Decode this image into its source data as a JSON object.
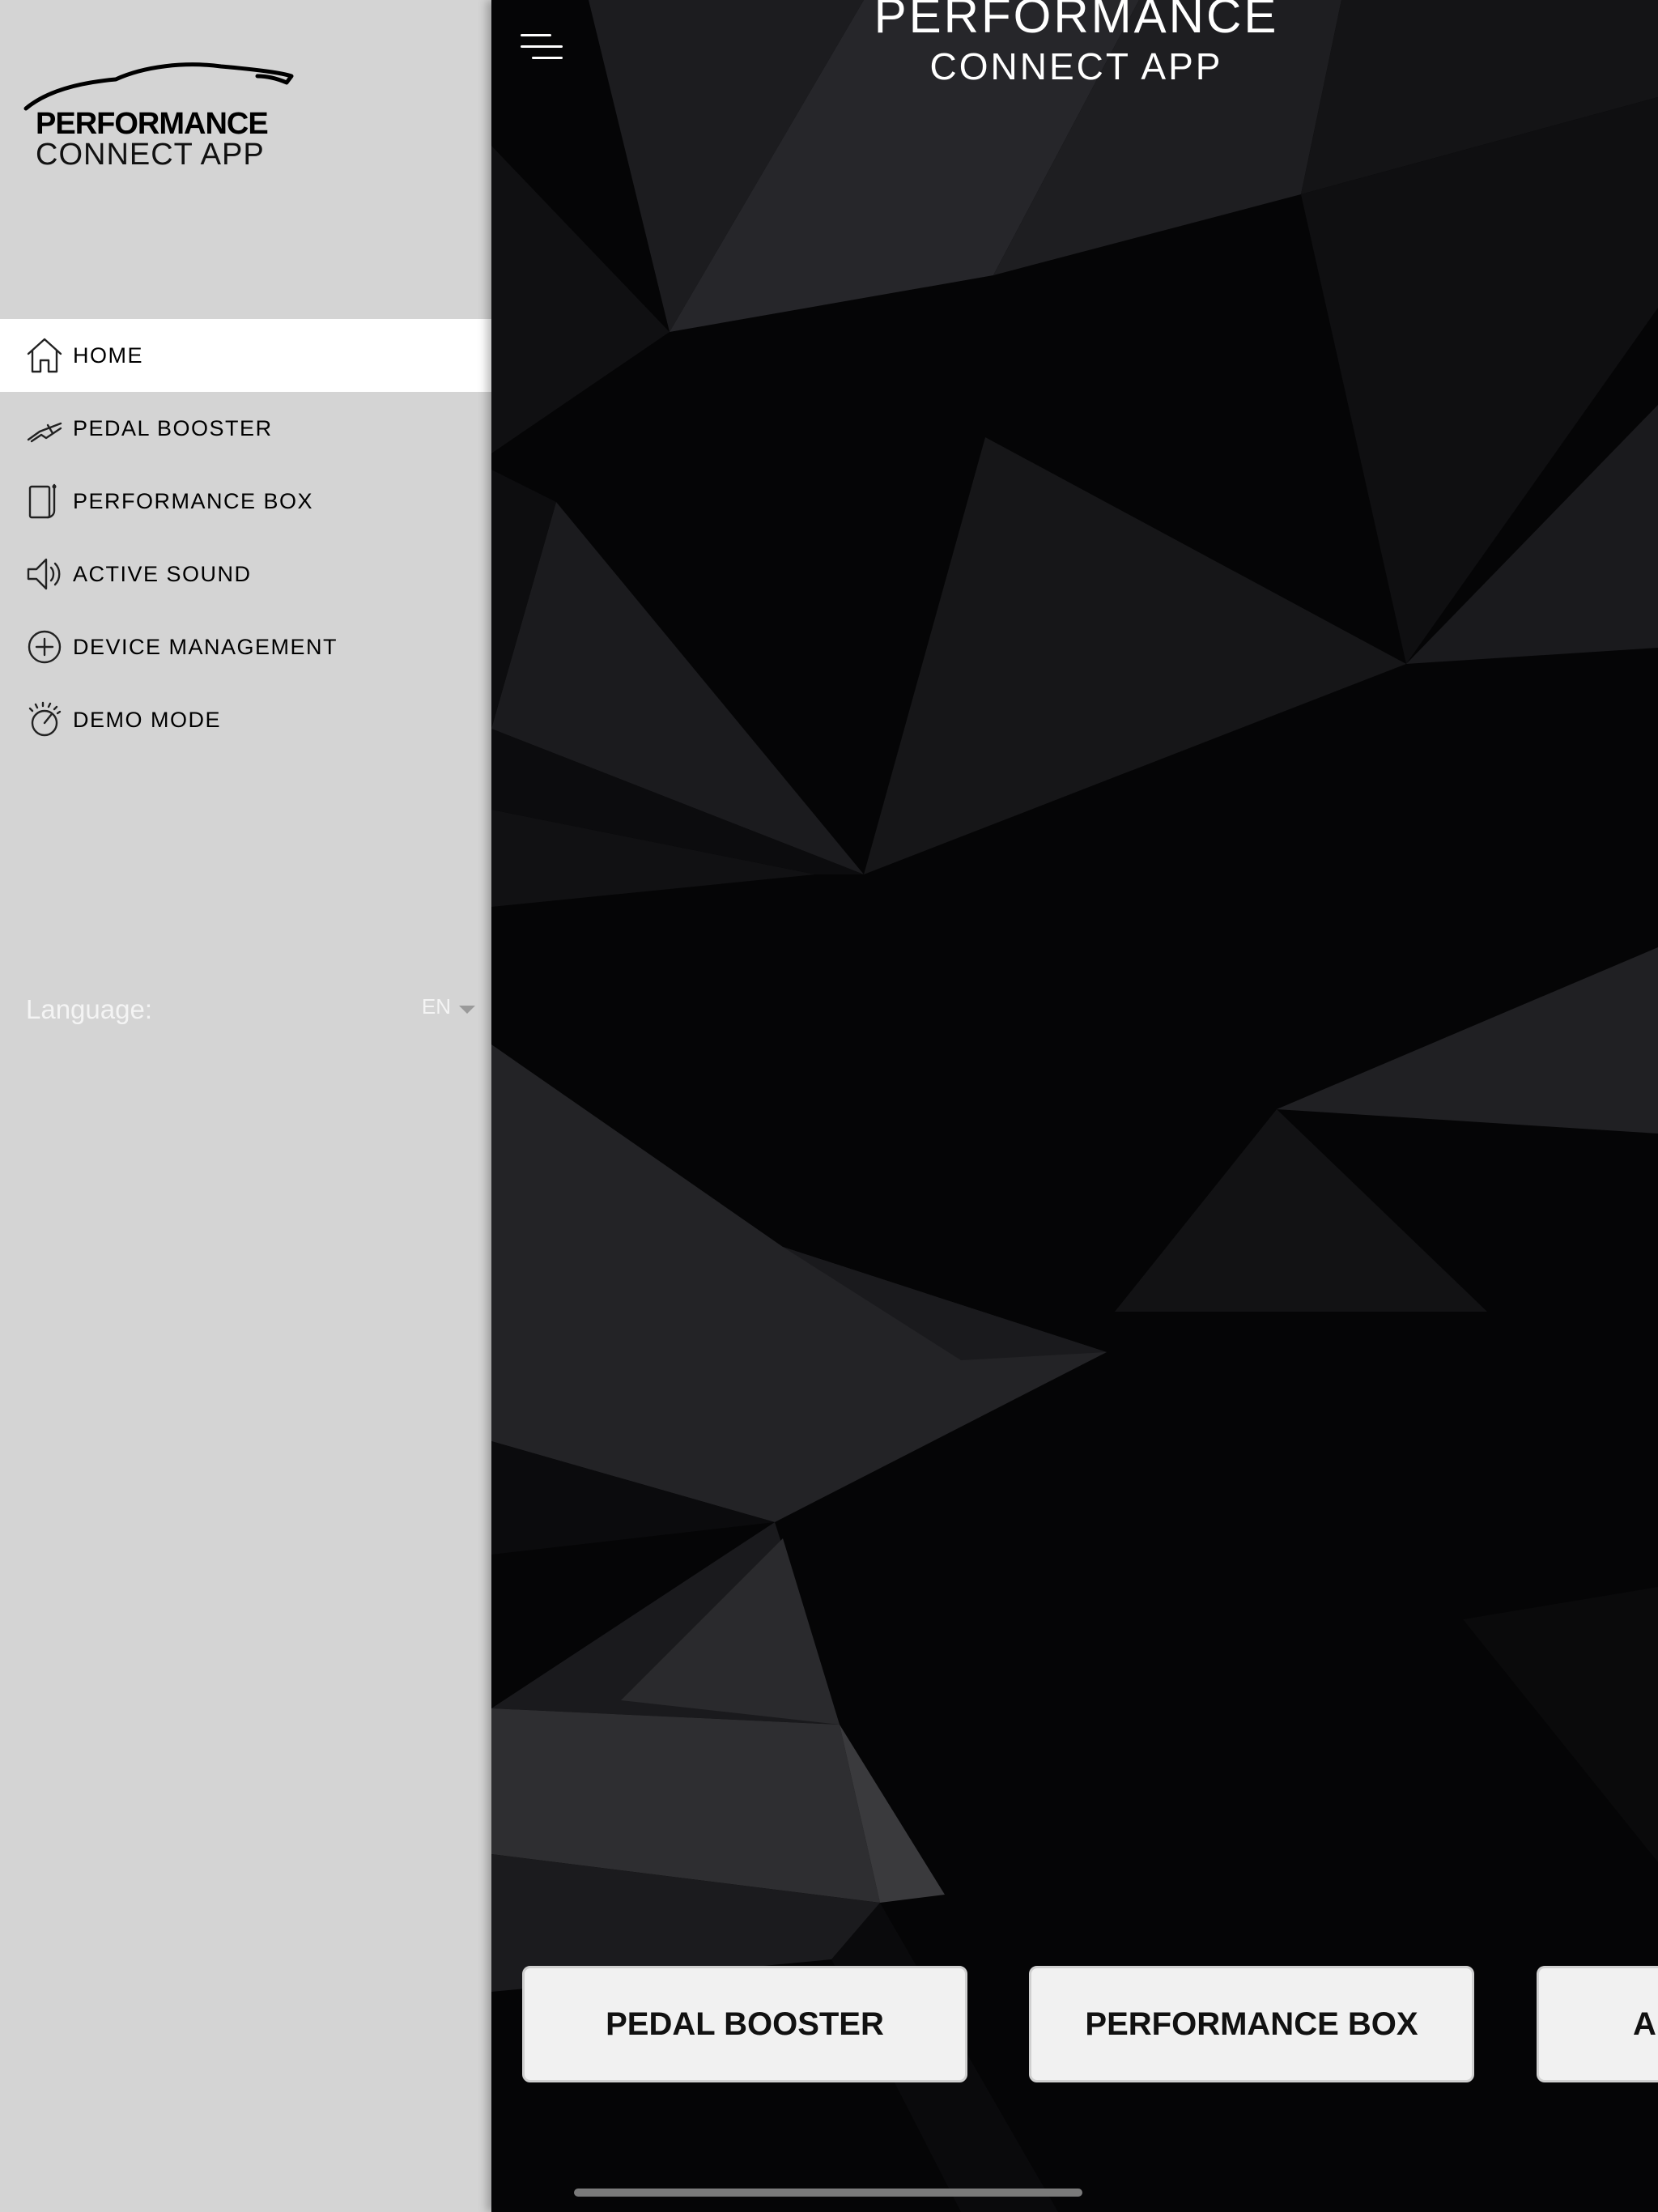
{
  "logo": {
    "line1": "PERFORMANCE",
    "line2": "CONNECT APP"
  },
  "sidebar": {
    "items": [
      {
        "label": "HOME",
        "icon": "home-icon",
        "active": true
      },
      {
        "label": "PEDAL BOOSTER",
        "icon": "pedal-icon",
        "active": false
      },
      {
        "label": "PERFORMANCE BOX",
        "icon": "performance-box-icon",
        "active": false
      },
      {
        "label": "ACTIVE SOUND",
        "icon": "speaker-icon",
        "active": false
      },
      {
        "label": "DEVICE MANAGEMENT",
        "icon": "plus-circle-icon",
        "active": false
      },
      {
        "label": "DEMO MODE",
        "icon": "speedometer-icon",
        "active": false
      }
    ],
    "language": {
      "label": "Language:",
      "value": "EN"
    }
  },
  "header": {
    "title_line1": "PERFORMANCE",
    "title_line2": "CONNECT APP"
  },
  "main": {
    "buttons": [
      {
        "label": "PEDAL BOOSTER"
      },
      {
        "label": "PERFORMANCE BOX"
      },
      {
        "label": "A"
      }
    ]
  },
  "colors": {
    "sidebar_bg": "#d4d4d4",
    "active_item_bg": "#ffffff",
    "main_bg": "#050506",
    "button_bg": "#f1f1f1"
  }
}
